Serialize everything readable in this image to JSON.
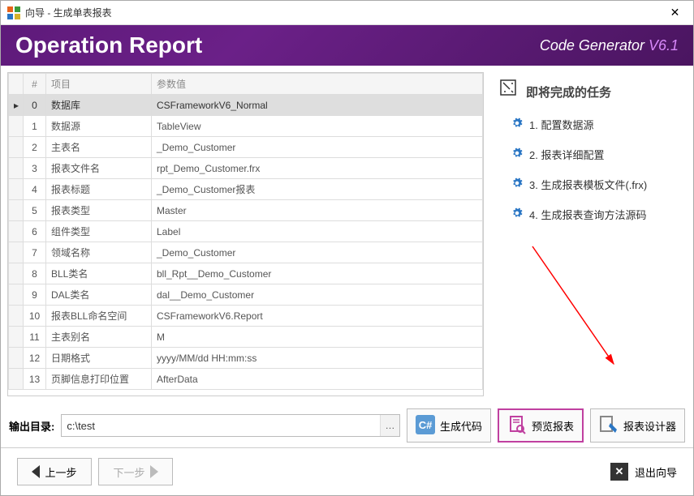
{
  "titlebar": {
    "title": "向导 - 生成单表报表"
  },
  "header": {
    "title": "Operation Report",
    "brand_text": "Code Generator ",
    "brand_version": "V6.1"
  },
  "grid": {
    "header_num": "#",
    "header_name": "项目",
    "header_value": "参数值",
    "rows": [
      {
        "n": "0",
        "name": "数据库",
        "value": "CSFrameworkV6_Normal"
      },
      {
        "n": "1",
        "name": "数据源",
        "value": "TableView"
      },
      {
        "n": "2",
        "name": "主表名",
        "value": "_Demo_Customer"
      },
      {
        "n": "3",
        "name": "报表文件名",
        "value": "rpt_Demo_Customer.frx"
      },
      {
        "n": "4",
        "name": "报表标题",
        "value": "_Demo_Customer报表"
      },
      {
        "n": "5",
        "name": "报表类型",
        "value": "Master"
      },
      {
        "n": "6",
        "name": "组件类型",
        "value": "Label"
      },
      {
        "n": "7",
        "name": "领域名称",
        "value": "_Demo_Customer"
      },
      {
        "n": "8",
        "name": "BLL类名",
        "value": "bll_Rpt__Demo_Customer"
      },
      {
        "n": "9",
        "name": "DAL类名",
        "value": "dal__Demo_Customer"
      },
      {
        "n": "10",
        "name": "报表BLL命名空间",
        "value": "CSFrameworkV6.Report"
      },
      {
        "n": "11",
        "name": "主表别名",
        "value": "M"
      },
      {
        "n": "12",
        "name": "日期格式",
        "value": "yyyy/MM/dd HH:mm:ss"
      },
      {
        "n": "13",
        "name": "页脚信息打印位置",
        "value": "AfterData"
      }
    ]
  },
  "sidebar": {
    "title": "即将完成的任务",
    "tasks": [
      "1. 配置数据源",
      "2. 报表详细配置",
      "3. 生成报表模板文件(.frx)",
      "4. 生成报表查询方法源码"
    ]
  },
  "output": {
    "label": "输出目录:",
    "value": "c:\\test",
    "browse": "…",
    "gen_code": "生成代码",
    "preview": "预览报表",
    "designer": "报表设计器"
  },
  "footer": {
    "prev": "上一步",
    "next": "下一步",
    "exit": "退出向导"
  }
}
